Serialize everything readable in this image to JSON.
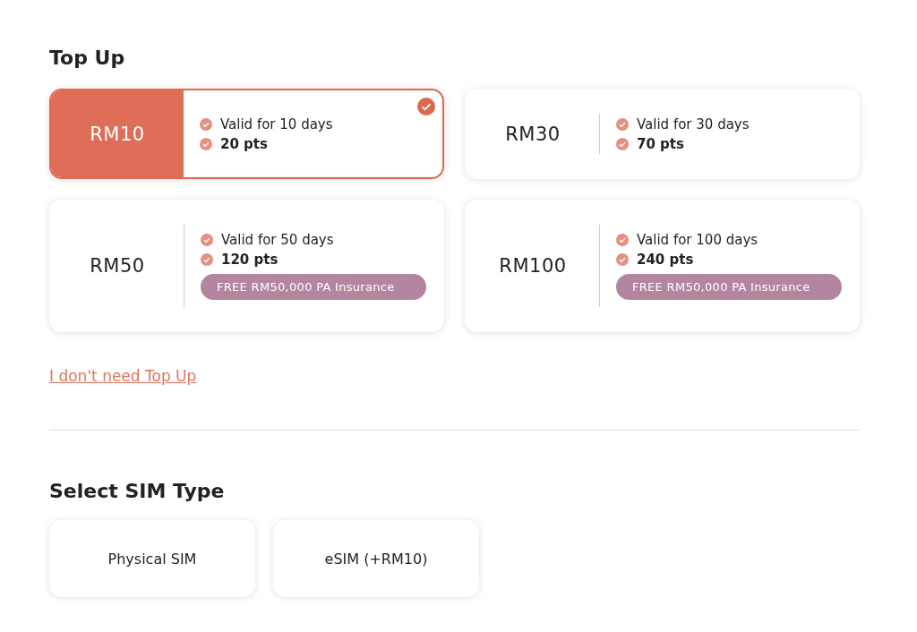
{
  "top_up": {
    "heading": "Top Up",
    "plans": [
      {
        "price": "RM10",
        "validity": "Valid for 10 days",
        "points": "20 pts",
        "selected": true
      },
      {
        "price": "RM30",
        "validity": "Valid for 30 days",
        "points": "70 pts",
        "selected": false
      },
      {
        "price": "RM50",
        "validity": "Valid for 50 days",
        "points": "120 pts",
        "badge": "FREE RM50,000 PA Insurance",
        "selected": false
      },
      {
        "price": "RM100",
        "validity": "Valid for 100 days",
        "points": "240 pts",
        "badge": "FREE RM50,000 PA Insurance",
        "selected": false
      }
    ],
    "skip_link": "I don't need Top Up"
  },
  "sim_type": {
    "heading": "Select SIM Type",
    "options": [
      {
        "label": "Physical SIM",
        "selected": false
      },
      {
        "label": "eSIM (+RM10)",
        "selected": false
      }
    ]
  }
}
